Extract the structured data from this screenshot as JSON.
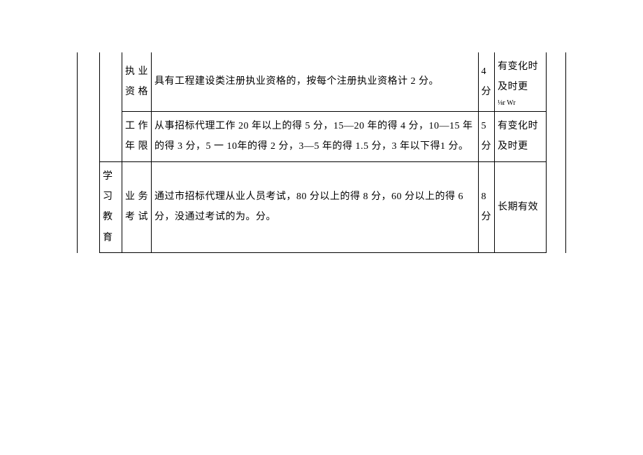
{
  "rows": [
    {
      "col_b": "",
      "col_c": "执业资格",
      "col_d": "具有工程建设类注册执业资格的，按每个注册执业资格计 2 分。",
      "col_e": "4分",
      "col_f": "有变化时及时更",
      "col_f_suffix": "⅛r\nWr"
    },
    {
      "col_b": "",
      "col_c": "工 作年限",
      "col_d": "从事招标代理工作 20 年以上的得 5 分，15—20 年的得 4 分，10—15 年的得 3 分，5 一 10年的得 2 分，3—5 年的得 1.5 分，3 年以下得1 分。",
      "col_e": "5分",
      "col_f": "有变化时及时更"
    },
    {
      "col_b": "学习教育",
      "col_c": "业 务考试",
      "col_d": "通过市招标代理从业人员考试，80 分以上的得 8 分，60 分以上的得 6 分，没通过考试的为。分。",
      "col_e": "8分",
      "col_f": "长期有效"
    }
  ]
}
